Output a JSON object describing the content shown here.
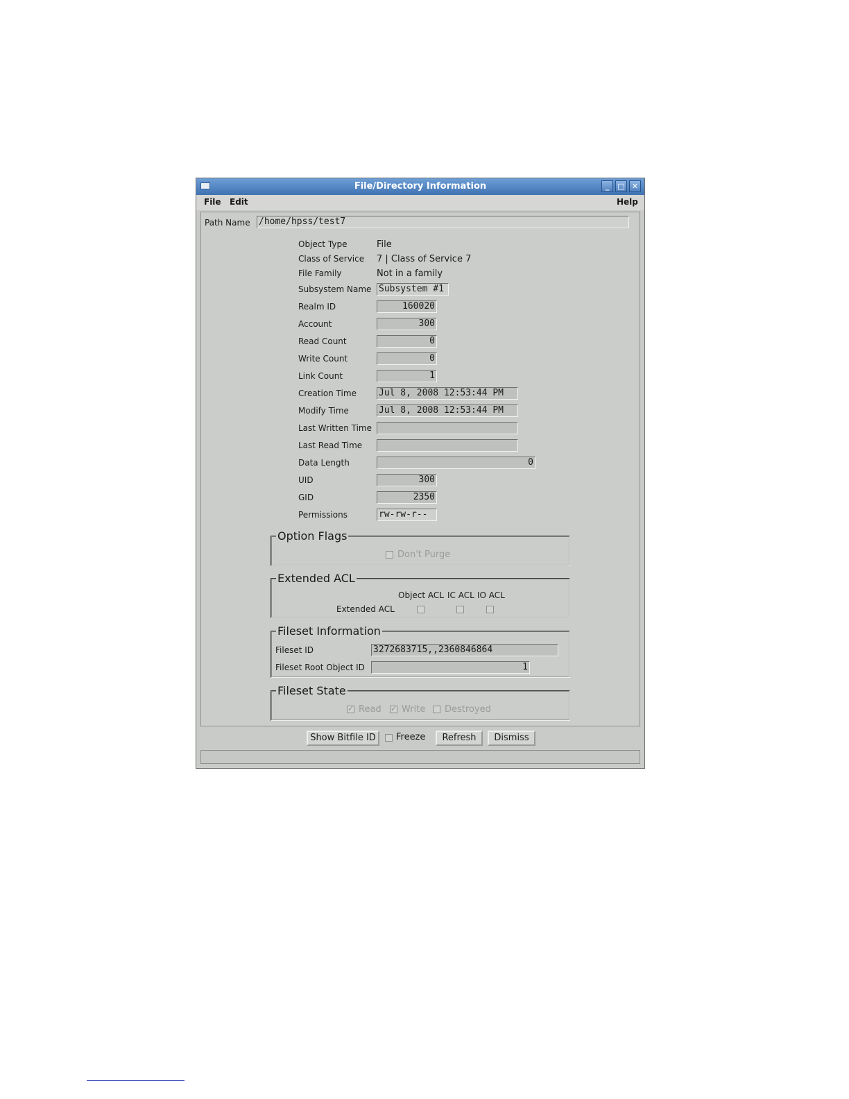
{
  "window": {
    "title": "File/Directory Information",
    "controls": [
      "minimize-icon",
      "maximize-icon",
      "close-icon"
    ]
  },
  "menubar": {
    "file": "File",
    "edit": "Edit",
    "help": "Help"
  },
  "path": {
    "label": "Path Name",
    "value": "/home/hpss/test7"
  },
  "fields": {
    "object_type": {
      "label": "Object Type",
      "value": "File"
    },
    "class_of_service": {
      "label": "Class of Service",
      "value": "7 | Class of Service 7"
    },
    "file_family": {
      "label": "File Family",
      "value": "Not in a family"
    },
    "subsystem_name": {
      "label": "Subsystem Name",
      "value": "Subsystem #1"
    },
    "realm_id": {
      "label": "Realm ID",
      "value": "160020"
    },
    "account": {
      "label": "Account",
      "value": "300"
    },
    "read_count": {
      "label": "Read Count",
      "value": "0"
    },
    "write_count": {
      "label": "Write Count",
      "value": "0"
    },
    "link_count": {
      "label": "Link Count",
      "value": "1"
    },
    "creation_time": {
      "label": "Creation Time",
      "value": "Jul 8, 2008 12:53:44 PM"
    },
    "modify_time": {
      "label": "Modify Time",
      "value": "Jul 8, 2008 12:53:44 PM"
    },
    "last_written_time": {
      "label": "Last Written Time",
      "value": ""
    },
    "last_read_time": {
      "label": "Last Read Time",
      "value": ""
    },
    "data_length": {
      "label": "Data Length",
      "value": "0"
    },
    "uid": {
      "label": "UID",
      "value": "300"
    },
    "gid": {
      "label": "GID",
      "value": "2350"
    },
    "permissions": {
      "label": "Permissions",
      "value": "rw-rw-r--"
    }
  },
  "option_flags": {
    "title": "Option Flags",
    "dont_purge": {
      "label": "Don't Purge",
      "checked": false
    }
  },
  "extended_acl": {
    "title": "Extended ACL",
    "columns": [
      "Object ACL",
      "IC ACL",
      "IO ACL"
    ],
    "row_label": "Extended ACL",
    "checked": [
      false,
      false,
      false
    ]
  },
  "fileset_info": {
    "title": "Fileset Information",
    "fileset_id": {
      "label": "Fileset ID",
      "value": "3272683715,,2360846864"
    },
    "root_object_id": {
      "label": "Fileset Root Object ID",
      "value": "1"
    }
  },
  "fileset_state": {
    "title": "Fileset State",
    "read": {
      "label": "Read",
      "checked": true
    },
    "write": {
      "label": "Write",
      "checked": true
    },
    "destroyed": {
      "label": "Destroyed",
      "checked": false
    }
  },
  "buttons": {
    "show_bitfile_id": "Show Bitfile ID",
    "freeze": "Freeze",
    "refresh": "Refresh",
    "dismiss": "Dismiss"
  },
  "status": {
    "text": ""
  }
}
